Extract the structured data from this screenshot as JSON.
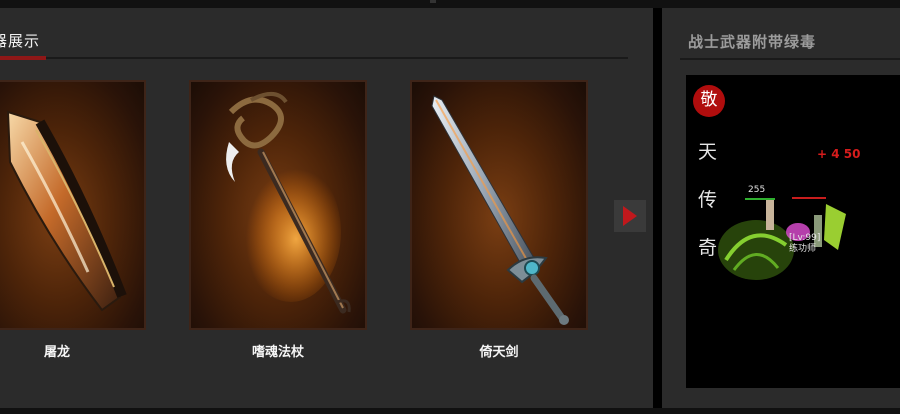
{
  "showcase": {
    "heading": "器展示",
    "items": [
      {
        "name": "屠龙",
        "icon": "dragon-slayer-blade"
      },
      {
        "name": "嗜魂法杖",
        "icon": "soul-eater-staff"
      },
      {
        "name": "倚天剑",
        "icon": "yitian-sword"
      }
    ],
    "next_icon": "right-arrow-icon"
  },
  "video_panel": {
    "heading": "战士武器附带绿毒",
    "seal_text": "敬",
    "vertical_text": [
      "天",
      "传",
      "奇"
    ],
    "damage_text": "+ 4 50",
    "level_text": "255",
    "nameplate_line1": "[Lv:99]",
    "nameplate_line2": "练功师"
  },
  "colors": {
    "accent": "#8f1717",
    "panel_bg": "#2b2b2b",
    "arrow": "#c0181c",
    "seal": "#b00d0d"
  }
}
